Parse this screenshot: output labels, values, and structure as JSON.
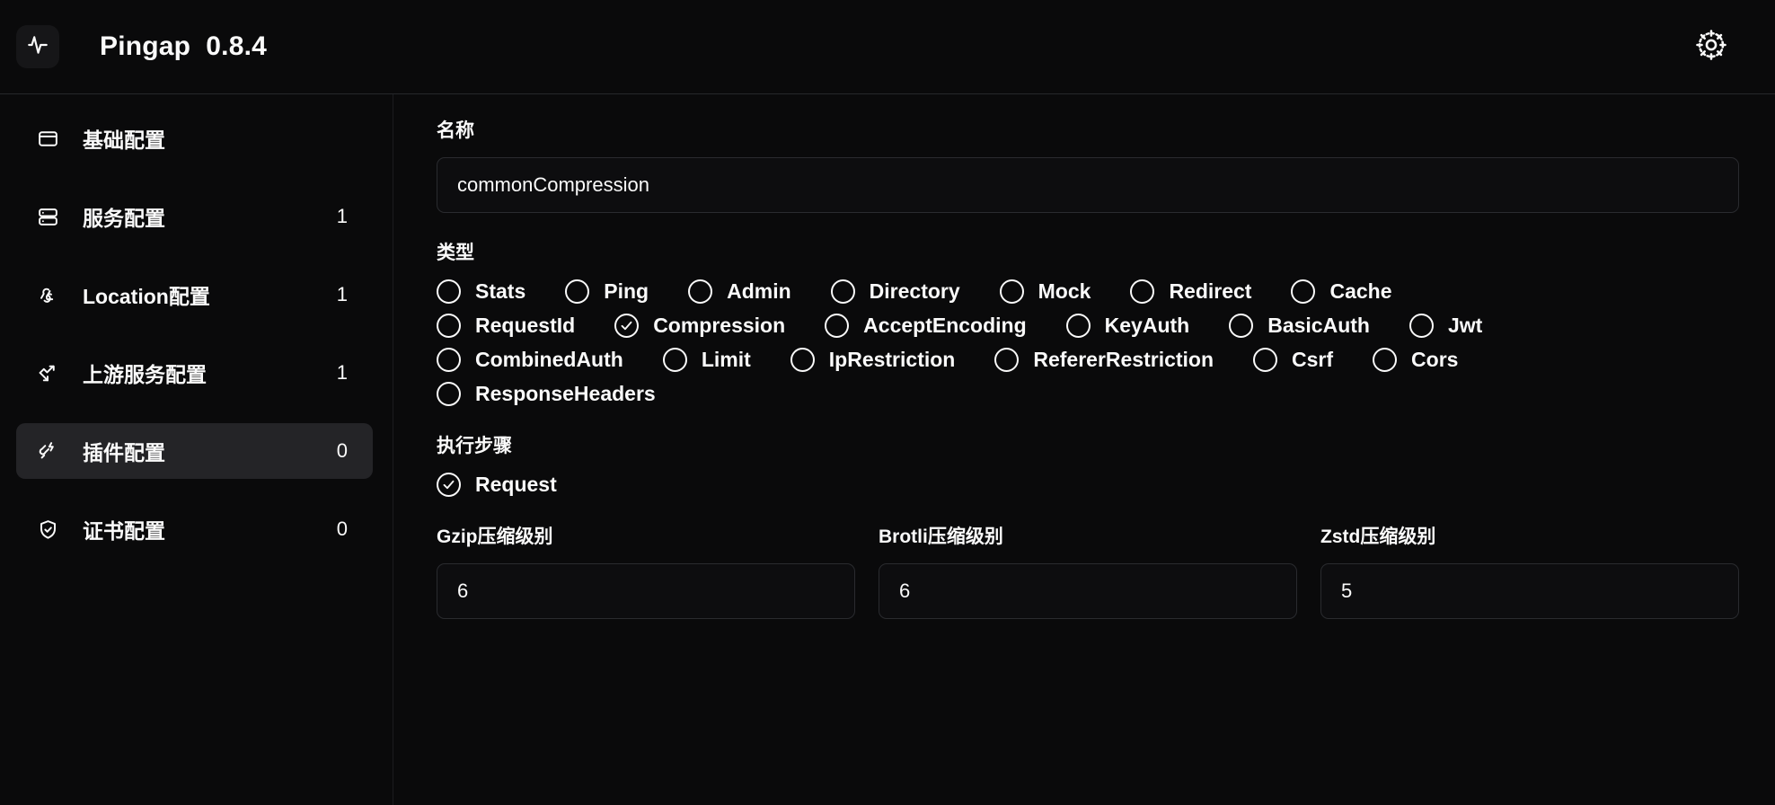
{
  "header": {
    "logo_icon": "activity-pulse-icon",
    "title": "Pingap  0.8.4",
    "settings_icon": "gear-icon"
  },
  "sidebar": {
    "items": [
      {
        "label": "基础配置",
        "badge": "",
        "icon": "window-icon",
        "active": false
      },
      {
        "label": "服务配置",
        "badge": "1",
        "icon": "server-icon",
        "active": false
      },
      {
        "label": "Location配置",
        "badge": "1",
        "icon": "webhook-icon",
        "active": false
      },
      {
        "label": "上游服务配置",
        "badge": "1",
        "icon": "network-trend-icon",
        "active": false
      },
      {
        "label": "插件配置",
        "badge": "0",
        "icon": "plug-zap-icon",
        "active": true
      },
      {
        "label": "证书配置",
        "badge": "0",
        "icon": "shield-check-icon",
        "active": false
      }
    ]
  },
  "main": {
    "name_section": {
      "label": "名称",
      "value": "commonCompression",
      "placeholder": ""
    },
    "type_section": {
      "label": "类型",
      "selected": "Compression",
      "options": [
        {
          "label": "Stats",
          "checked": false
        },
        {
          "label": "Ping",
          "checked": false
        },
        {
          "label": "Admin",
          "checked": false
        },
        {
          "label": "Directory",
          "checked": false
        },
        {
          "label": "Mock",
          "checked": false
        },
        {
          "label": "Redirect",
          "checked": false
        },
        {
          "label": "Cache",
          "checked": false
        },
        {
          "label": "RequestId",
          "checked": false
        },
        {
          "label": "Compression",
          "checked": true
        },
        {
          "label": "AcceptEncoding",
          "checked": false
        },
        {
          "label": "KeyAuth",
          "checked": false
        },
        {
          "label": "BasicAuth",
          "checked": false
        },
        {
          "label": "Jwt",
          "checked": false
        },
        {
          "label": "CombinedAuth",
          "checked": false
        },
        {
          "label": "Limit",
          "checked": false
        },
        {
          "label": "IpRestriction",
          "checked": false
        },
        {
          "label": "RefererRestriction",
          "checked": false
        },
        {
          "label": "Csrf",
          "checked": false
        },
        {
          "label": "Cors",
          "checked": false
        },
        {
          "label": "ResponseHeaders",
          "checked": false
        }
      ],
      "row_breaks": [
        7,
        13,
        19
      ]
    },
    "step_section": {
      "label": "执行步骤",
      "options": [
        {
          "label": "Request",
          "checked": true
        }
      ]
    },
    "levels": [
      {
        "label": "Gzip压缩级别",
        "value": "6"
      },
      {
        "label": "Brotli压缩级别",
        "value": "6"
      },
      {
        "label": "Zstd压缩级别",
        "value": "5"
      }
    ]
  }
}
